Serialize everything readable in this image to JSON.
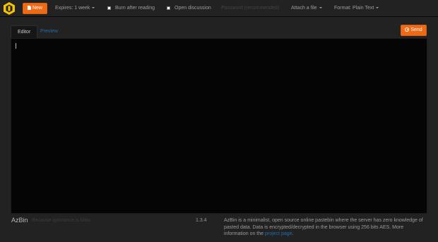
{
  "colors": {
    "accent": "#ef6a16",
    "link": "#1e6fa8",
    "background": "#222222",
    "editor_bg": "#050505"
  },
  "navbar": {
    "logo_icon": "azbin-logo-icon",
    "new_button": {
      "label": "New",
      "icon": "document-icon"
    },
    "expires": {
      "label": "Expires: 1 week",
      "icon": "caret-down-icon"
    },
    "burn_after_reading": {
      "label": "Burn after reading",
      "checked": false
    },
    "open_discussion": {
      "label": "Open discussion",
      "checked": false
    },
    "password": {
      "placeholder": "Password (recommended)"
    },
    "attach": {
      "label": "Attach a file",
      "icon": "caret-down-icon"
    },
    "format": {
      "label": "Format: Plain Text",
      "icon": "caret-down-icon"
    }
  },
  "panel": {
    "tabs": [
      {
        "label": "Editor",
        "active": true
      },
      {
        "label": "Preview",
        "active": false
      }
    ],
    "send_button": {
      "label": "Send",
      "icon": "circle-arrow-right-icon"
    },
    "editor_text": ""
  },
  "footer": {
    "brand": "AzBin",
    "tagline": "Because ignorance is bliss",
    "version": "1.3.4",
    "about_text": "AzBin is a minimalist, open source online pastebin where the server has zero knowledge of pasted data. Data is encrypted/decrypted in the browser using 256 bits AES. More information on the ",
    "about_link": "project page",
    "about_end": "."
  }
}
